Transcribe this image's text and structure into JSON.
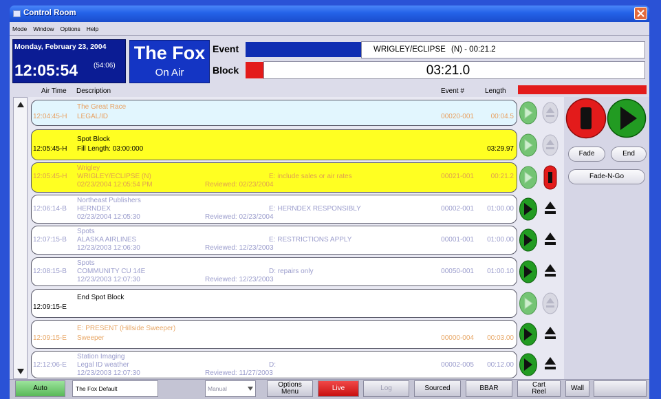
{
  "window": {
    "title": "Control Room"
  },
  "menu": [
    "Mode",
    "Window",
    "Options",
    "Help"
  ],
  "clock": {
    "date": "Monday, February 23, 2004",
    "time": "12:05:54",
    "remaining": "(54:06)"
  },
  "station": {
    "name": "The Fox",
    "status": "On Air"
  },
  "event": {
    "label": "Event",
    "name": "WRIGLEY/ECLIPSE",
    "info": "(N) - 00:21.2"
  },
  "block": {
    "label": "Block",
    "time": "03:21.0"
  },
  "list_header": {
    "air_time": "Air Time",
    "description": "Description",
    "event_no": "Event #",
    "length": "Length"
  },
  "rows": [
    {
      "line1": "The Great Race",
      "time": "12:04:45-H",
      "desc": "LEGAL/ID",
      "event_no": "00020-001",
      "length": "00:04.5",
      "play": "disabled",
      "eject": "disabled",
      "bg": "#e2f6fe",
      "fg": "#e8a060"
    },
    {
      "line1": "Spot Block",
      "time": "12:05:45-H",
      "desc": "Fill Length: 03:00:000",
      "length": "03:29.97",
      "play": "disabled",
      "eject": "disabled",
      "bg": "#ffff22",
      "fg": "#000000"
    },
    {
      "line1": "Wrigley",
      "time": "12:05:45-H",
      "desc": "WRIGLEY/ECLIPSE (N)",
      "line3": "02/23/2004 12:05:54 PM",
      "reviewed": "Reviewed: 02/23/2004",
      "note": "E: include sales or air rates",
      "event_no": "00021-001",
      "length": "00:21.2",
      "play": "disabled",
      "eject": "stop",
      "bg": "#ffff22",
      "fg": "#e0a050"
    },
    {
      "line1": "Northeast Publishers",
      "time": "12:06:14-B",
      "desc": "HERNDEX",
      "line3": "02/23/2004 12:05:30",
      "reviewed": "Reviewed: 02/23/2004",
      "note": "E: HERNDEX RESPONSIBLY",
      "event_no": "00002-001",
      "length": "01:00.00",
      "play": "enabled",
      "eject": "enabled",
      "bg": "#ffffff",
      "fg": "#9a9ccc"
    },
    {
      "line1": "Spots",
      "time": "12:07:15-B",
      "desc": "ALASKA AIRLINES",
      "line3": "12/23/2003 12:06:30",
      "reviewed": "Reviewed: 12/23/2003",
      "note": "E: RESTRICTIONS APPLY",
      "event_no": "00001-001",
      "length": "01:00.00",
      "play": "enabled",
      "eject": "enabled",
      "bg": "#ffffff",
      "fg": "#9a9ccc"
    },
    {
      "line1": "Spots",
      "time": "12:08:15-B",
      "desc": "COMMUNITY CU 14E",
      "line3": "12/23/2003 12:07:30",
      "reviewed": "Reviewed: 12/23/2003",
      "note": "D: repairs only",
      "event_no": "00050-001",
      "length": "01:00.10",
      "play": "enabled",
      "eject": "enabled",
      "bg": "#ffffff",
      "fg": "#9a9ccc"
    },
    {
      "line1": "End Spot Block",
      "time": "12:09:15-E",
      "play": "disabled",
      "eject": "disabled",
      "bg": "#ffffff",
      "fg": "#000000"
    },
    {
      "line1": "E: PRESENT (Hillside Sweeper)",
      "time": "12:09:15-E",
      "desc": "Sweeper",
      "event_no": "00000-004",
      "length": "00:03.00",
      "play": "enabled",
      "eject": "enabled",
      "bg": "#ffffff",
      "fg": "#e8a868"
    },
    {
      "line1": "Station Imaging",
      "time": "12:12:06-E",
      "desc": "Legal ID weather",
      "line3": "12/23/2003 12:07:30",
      "reviewed": "Reviewed: 11/27/2003",
      "note": "D:",
      "event_no": "00002-005",
      "length": "00:12.00",
      "play": "enabled",
      "eject": "enabled",
      "bg": "#ffffff",
      "fg": "#9a9ccc"
    }
  ],
  "controls": {
    "fade": "Fade",
    "end": "End",
    "fade_n_go": "Fade-N-Go"
  },
  "bottom": {
    "auto": "Auto",
    "profile": "The Fox Default",
    "mode": "Manual",
    "options": "Options",
    "options_sub": "Menu",
    "live": "Live",
    "log": "Log",
    "sourced": "Sourced",
    "bbar": "BBAR",
    "cart": "Cart",
    "cart_sub": "Reel",
    "wall": "Wall"
  },
  "colors": {
    "frame": "#2a52d6",
    "title_bar": "#2462e8",
    "clock_panel": "#0b1c94",
    "station_panel": "#1435c4",
    "event_bar": "#0f2db2",
    "alert_red": "#e31b1b",
    "play_green": "#229b22"
  }
}
